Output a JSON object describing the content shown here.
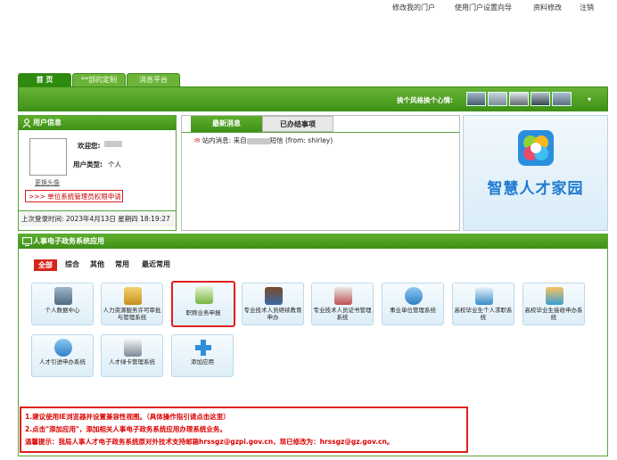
{
  "top_links": [
    "修改我的门户",
    "使用门户设置向导",
    "资料修改",
    "注销"
  ],
  "nav_tabs": [
    "首 页",
    "**部的定制",
    "消息平台"
  ],
  "theme_switch": {
    "label": "换个风格换个心情:"
  },
  "user_info": {
    "title": "用户信息",
    "welcome_label": "欢迎您:",
    "type_label": "用户类型:",
    "type_value": "个人",
    "change_avatar": "更换头像",
    "apply_link": ">>> 单位系统管理员权限申请",
    "last_login": "上次登录时间: 2023年4月13日 星期四 18:19:27"
  },
  "messages": {
    "tabs": [
      "最新消息",
      "已办结事项"
    ],
    "line_prefix": "站内消息: 来自",
    "line_suffix": "短信 (from: shirley)"
  },
  "brand": {
    "title": "智慧人才家园"
  },
  "apps": {
    "title": "人事电子政务系统应用",
    "categories": [
      "全部",
      "综合",
      "其他",
      "常用",
      "最近常用"
    ],
    "tiles": [
      {
        "label": "个人数据中心"
      },
      {
        "label": "人力资源服务许可审批与管理系统"
      },
      {
        "label": "职称业务申报"
      },
      {
        "label": "专业技术人员继续教育申办"
      },
      {
        "label": "专业技术人员证书管理系统"
      },
      {
        "label": "事业单位管理系统"
      },
      {
        "label": "高校毕业生个人求职系统"
      },
      {
        "label": "高校毕业生接收申办系统"
      },
      {
        "label": "人才引进申办系统"
      },
      {
        "label": "人才绿卡管理系统"
      },
      {
        "label": "添加应用"
      }
    ]
  },
  "notice": {
    "line1": "1.建议使用IE浏览器并设置兼容性视图。（具体操作指引请点击这里）",
    "line2": "2.点击\"添加应用\"，添加相关人事电子政务系统应用办理系统业务。",
    "line3": "温馨提示：我局人事人才电子政务系统原对外技术支持邮箱hrssgz@gzpi.gov.cn，现已修改为：hrssgz@gz.gov.cn。"
  },
  "colors": {
    "accent_green": "#3e9018",
    "alert_red": "#d00000",
    "brand_blue": "#1f7bd0"
  }
}
